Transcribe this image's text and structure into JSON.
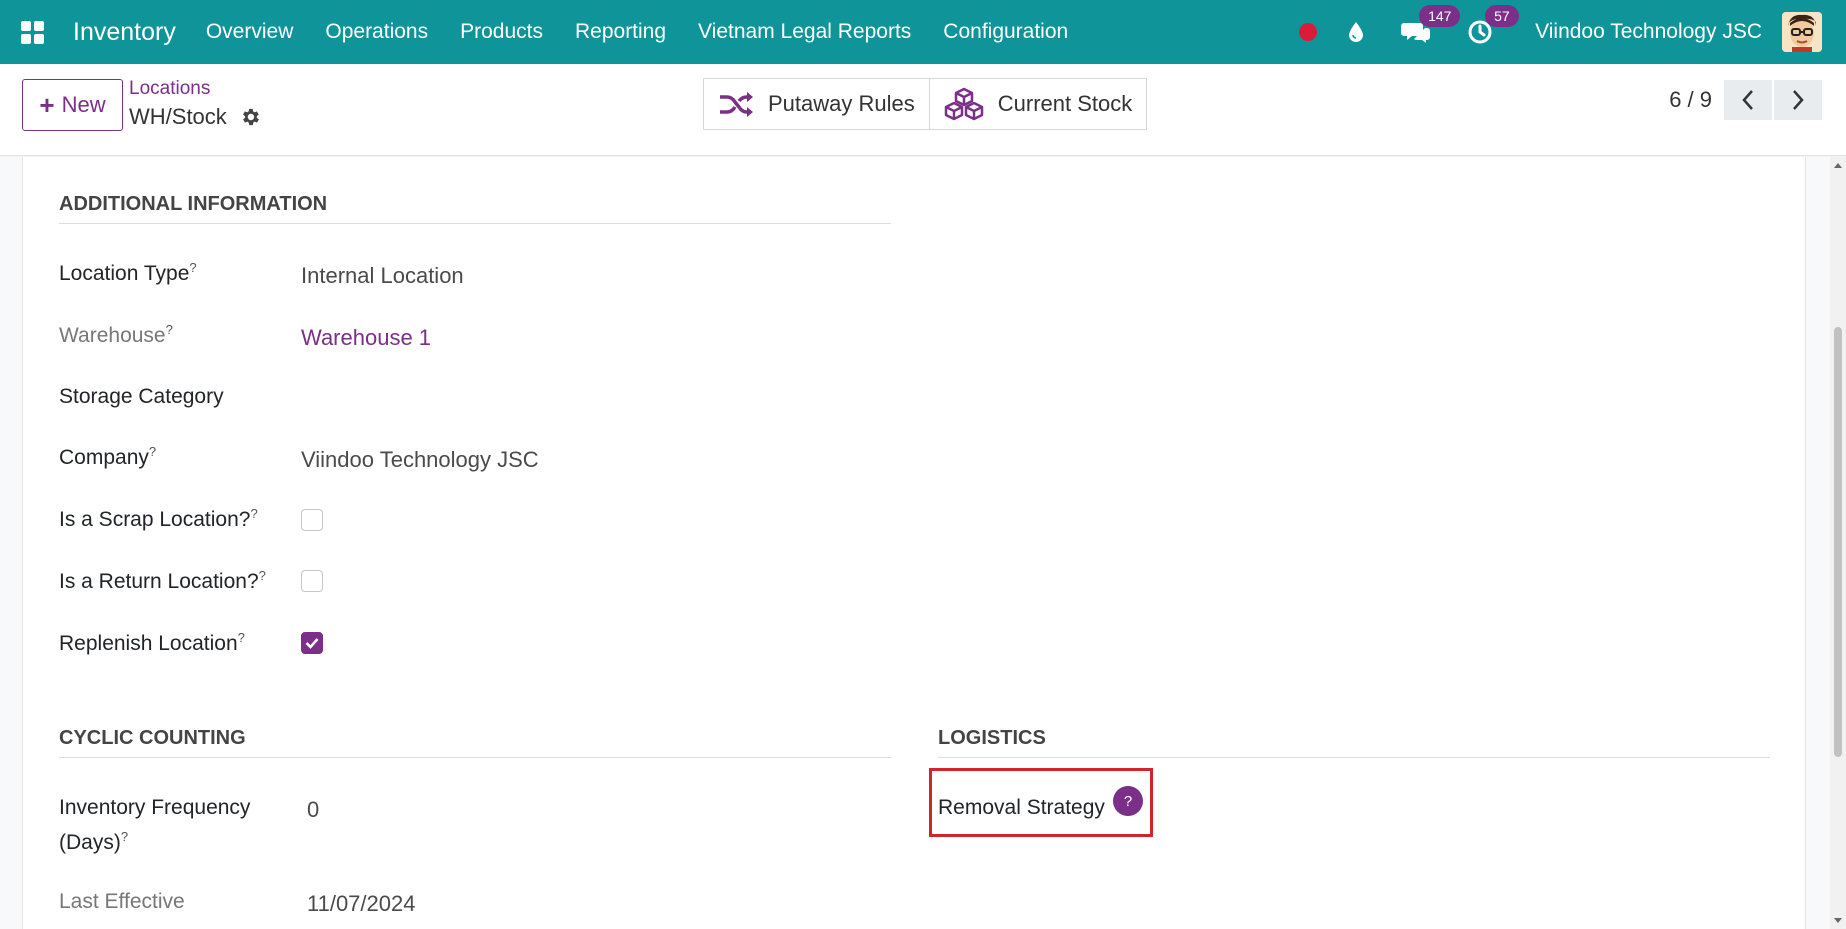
{
  "navbar": {
    "app_title": "Inventory",
    "menu": [
      "Overview",
      "Operations",
      "Products",
      "Reporting",
      "Vietnam Legal Reports",
      "Configuration"
    ],
    "messages_count": "147",
    "activities_count": "57",
    "company": "Viindoo Technology JSC",
    "colors": {
      "navbar_bg": "#0f9599",
      "accent": "#7b2f88",
      "record_dot": "#dc1a3a"
    }
  },
  "control_panel": {
    "new_label": "New",
    "breadcrumb_parent": "Locations",
    "breadcrumb_current": "WH/Stock",
    "putaway_rules_label": "Putaway Rules",
    "current_stock_label": "Current Stock",
    "pager_value": "6 / 9"
  },
  "additional_info": {
    "title": "ADDITIONAL INFORMATION",
    "location_type_label": "Location Type",
    "location_type_value": "Internal Location",
    "warehouse_label": "Warehouse",
    "warehouse_value": "Warehouse 1",
    "storage_category_label": "Storage Category",
    "company_label": "Company",
    "company_value": "Viindoo Technology JSC",
    "scrap_label": "Is a Scrap Location?",
    "scrap_checked": false,
    "return_label": "Is a Return Location?",
    "return_checked": false,
    "replenish_label": "Replenish Location",
    "replenish_checked": true
  },
  "cyclic_counting": {
    "title": "CYCLIC COUNTING",
    "frequency_label_line1": "Inventory Frequency",
    "frequency_label_line2": "(Days)",
    "frequency_value": "0",
    "last_effective_label": "Last Effective",
    "last_effective_value": "11/07/2024"
  },
  "logistics": {
    "title": "LOGISTICS",
    "removal_strategy_label": "Removal Strategy",
    "help_glyph": "?"
  },
  "help_marker": "?"
}
